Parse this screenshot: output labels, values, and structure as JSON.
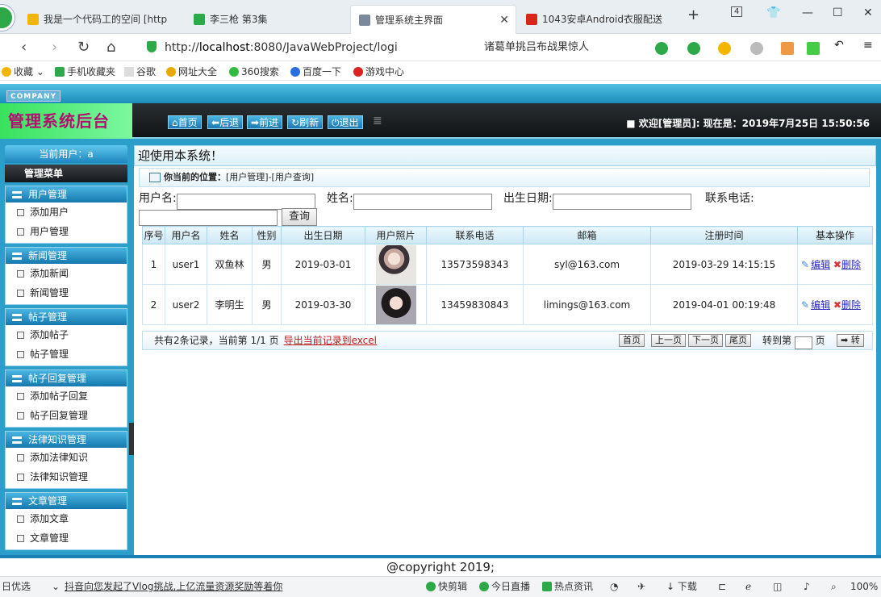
{
  "browser": {
    "tabs": [
      {
        "title": "我是一个代码工的空间 [http",
        "icon_color": "#f2b600",
        "active": false
      },
      {
        "title": "李三枪 第3集",
        "icon_color": "#2ea94a",
        "active": false
      },
      {
        "title": "管理系统主界面",
        "icon_color": "#7a8a9a",
        "active": true
      },
      {
        "title": "1043安卓Android衣服配送",
        "icon_color": "#d8261a",
        "active": false
      }
    ],
    "tab_count": "4",
    "url_prefix": "http://",
    "url_host": "localhost",
    "url_rest": ":8080/JavaWebProject/logi",
    "search_hint": "诸葛单挑吕布战果惊人",
    "bookmarks": [
      "收藏",
      "手机收藏夹",
      "谷歌",
      "网址大全",
      "360搜索",
      "百度一下",
      "游戏中心"
    ]
  },
  "app": {
    "company": "COMPANY",
    "title": "管理系统后台",
    "header_buttons": [
      "首页",
      "后退",
      "前进",
      "刷新",
      "退出"
    ],
    "welcome": "■ 欢迎[管理员]: 现在是：2019年7月25日 15:50:56",
    "current_user": "当前用户：a",
    "menu_title": "管理菜单",
    "menu_groups": [
      {
        "title": "用户管理",
        "items": [
          "添加用户",
          "用户管理"
        ]
      },
      {
        "title": "新闻管理",
        "items": [
          "添加新闻",
          "新闻管理"
        ]
      },
      {
        "title": "帖子管理",
        "items": [
          "添加帖子",
          "帖子管理"
        ]
      },
      {
        "title": "帖子回复管理",
        "items": [
          "添加帖子回复",
          "帖子回复管理"
        ]
      },
      {
        "title": "法律知识管理",
        "items": [
          "添加法律知识",
          "法律知识管理"
        ]
      },
      {
        "title": "文章管理",
        "items": [
          "添加文章",
          "文章管理"
        ]
      }
    ],
    "marquee": "迎使用本系统！",
    "location_label": "你当前的位置：",
    "location_path": "[用户管理]-[用户查询]",
    "filters": {
      "username_label": "用户名:",
      "name_label": "姓名:",
      "birth_label": "出生日期:",
      "phone_label": "联系电话:",
      "query_button": "查询"
    },
    "table": {
      "headers": [
        "序号",
        "用户名",
        "姓名",
        "性别",
        "出生日期",
        "用户照片",
        "联系电话",
        "邮箱",
        "注册时间",
        "基本操作"
      ],
      "rows": [
        {
          "no": "1",
          "username": "user1",
          "name": "双鱼林",
          "gender": "男",
          "birth": "2019-03-01",
          "phone": "13573598343",
          "email": "syl@163.com",
          "reg_time": "2019-03-29 14:15:15"
        },
        {
          "no": "2",
          "username": "user2",
          "name": "李明生",
          "gender": "男",
          "birth": "2019-03-30",
          "phone": "13459830843",
          "email": "limings@163.com",
          "reg_time": "2019-04-01 00:19:48"
        }
      ],
      "edit_label": "编辑",
      "delete_label": "删除"
    },
    "pager": {
      "summary": "共有2条记录，当前第 1/1 页",
      "export": "导出当前记录到excel",
      "first": "首页",
      "prev": "上一页",
      "next": "下一页",
      "last": "尾页",
      "jump_prefix": "转到第",
      "jump_suffix": "页",
      "go": "➡ 转"
    },
    "footer": "@copyright 2019;"
  },
  "statusbar": {
    "left": "日优选",
    "news": "抖音向您发起了Vlog挑战,上亿流量资源奖励等着你",
    "items": [
      "快剪辑",
      "今日直播",
      "热点资讯",
      "下载",
      "100%"
    ]
  }
}
